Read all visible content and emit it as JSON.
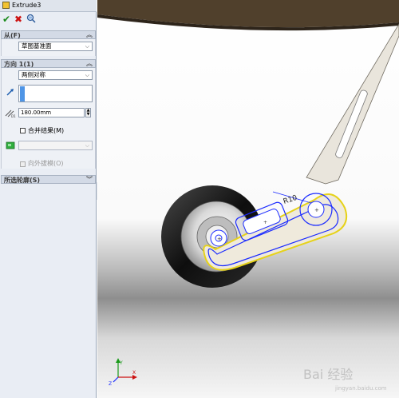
{
  "feature": {
    "title": "Extrude3"
  },
  "from": {
    "header": "从(F)",
    "value": "草图基准面"
  },
  "direction1": {
    "header": "方向 1(1)",
    "end_condition": "两侧对称",
    "depth": "180.00mm",
    "merge_label": "合并结果(M)",
    "draft_label": "向外拔模(O)"
  },
  "contours": {
    "header": "所选轮廓(S)"
  },
  "viewport": {
    "dimension_label": "R10",
    "colors": {
      "sketch": "#1a2aff",
      "highlight": "#e6d21a",
      "part": "#f0eee6"
    }
  },
  "watermark": {
    "text": "Bai 经验",
    "sub": "jingyan.baidu.com"
  },
  "icons": [
    "feature-icon",
    "ok-icon",
    "cancel-icon",
    "detailed-preview-icon",
    "collapse-icon",
    "reverse-direction-icon",
    "depth-icon",
    "merge-body-icon",
    "triad-icon"
  ]
}
